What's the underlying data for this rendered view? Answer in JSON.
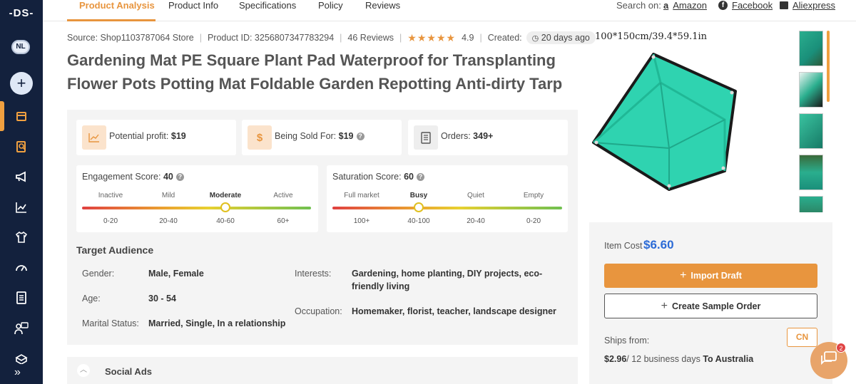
{
  "sidebar": {
    "logo": "-DS-",
    "user_badge": "NL",
    "add_label": "+",
    "icons": [
      "store-icon",
      "product-research-icon",
      "megaphone-icon",
      "chart-icon",
      "shirt-icon",
      "speedometer-icon",
      "document-icon",
      "support-icon",
      "box-icon"
    ],
    "expand_label": "»",
    "accent_color": "#f0a040",
    "bg_color": "#13213d"
  },
  "tabs": {
    "items": [
      "Product Analysis",
      "Product Info",
      "Specifications",
      "Policy",
      "Reviews"
    ],
    "active": "Product Analysis",
    "search_on_label": "Search on:",
    "links": [
      "Amazon",
      "Facebook",
      "Aliexpress"
    ]
  },
  "meta": {
    "source": "Source: Shop1103787064 Store",
    "product_id": "Product ID: 3256807347783294",
    "reviews": "46 Reviews",
    "rating": "4.9",
    "stars": "★★★★★",
    "created_label": "Created:",
    "created_value": "20 days ago"
  },
  "title": "Gardening Mat PE Square Plant Pad Waterproof for Transplanting Flower Pots Potting Mat Foldable Garden Repotting Anti-dirty Tarp",
  "stats": {
    "profit_label": "Potential profit:",
    "profit_value": "$19",
    "sold_label": "Being Sold For:",
    "sold_value": "$19",
    "sold_icon": "$",
    "orders_label": "Orders:",
    "orders_value": "349+"
  },
  "engagement": {
    "label": "Engagement Score:",
    "value": "40",
    "levels": [
      "Inactive",
      "Mild",
      "Moderate",
      "Active"
    ],
    "ranges": [
      "0-20",
      "20-40",
      "40-60",
      "60+"
    ],
    "selected_index": 2,
    "position_fraction": 0.625
  },
  "saturation": {
    "label": "Saturation Score:",
    "value": "60",
    "levels": [
      "Full market",
      "Busy",
      "Quiet",
      "Empty"
    ],
    "ranges": [
      "100+",
      "40-100",
      "20-40",
      "0-20"
    ],
    "selected_index": 1,
    "position_fraction": 0.375
  },
  "audience": {
    "title": "Target Audience",
    "gender_label": "Gender:",
    "gender_value": "Male, Female",
    "age_label": "Age:",
    "age_value": "30 - 54",
    "marital_label": "Marital Status:",
    "marital_value": "Married, Single, In a relationship",
    "interests_label": "Interests:",
    "interests_value": "Gardening, home planting, DIY projects, eco-friendly living",
    "occupation_label": "Occupation:",
    "occupation_value": "Homemaker, florist, teacher, landscape designer"
  },
  "social": {
    "label": "Social Ads",
    "chevron": "︿"
  },
  "product_image": {
    "dimensions": "100*150cm/39.4*59.1in",
    "thumbnail_count": 5
  },
  "buy": {
    "item_cost_label": "Item Cost",
    "item_cost_value": "$6.60",
    "import_label": "Import Draft",
    "sample_label": "Create Sample Order",
    "ships_from_label": "Ships from:",
    "ships_from_value": "CN",
    "shipping_price": "$2.96",
    "shipping_time": "/ 12 business days",
    "shipping_dest": "To Australia",
    "button_color": "#e8953e",
    "price_color": "#2c6bd6"
  },
  "chat": {
    "badge": "2"
  }
}
